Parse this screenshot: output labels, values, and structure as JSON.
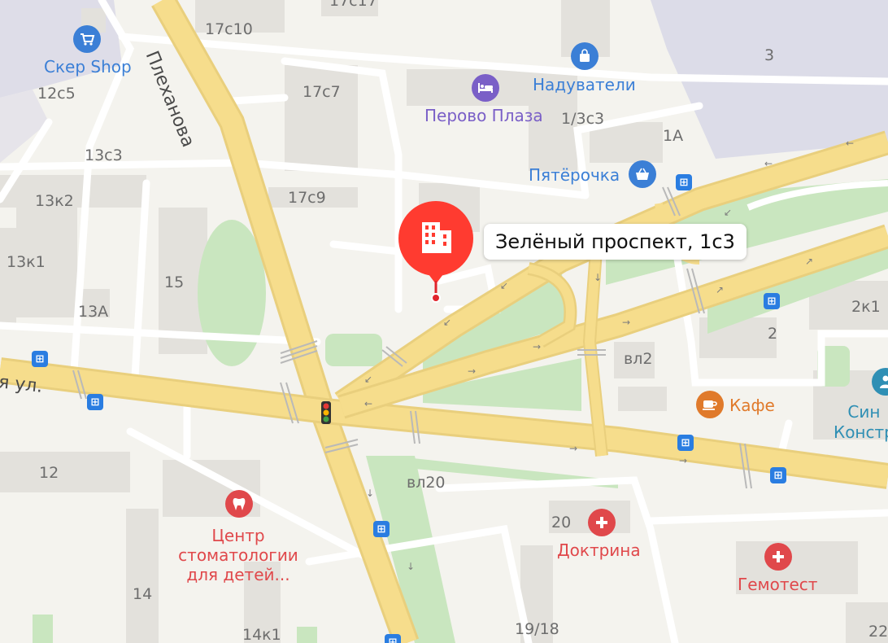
{
  "map": {
    "selected": {
      "address": "Зелёный проспект, 1с3"
    },
    "streets": [
      {
        "id": "plekhanova",
        "text": "Плеханова"
      },
      {
        "id": "left-street",
        "text": "я ул."
      }
    ],
    "pois": [
      {
        "id": "skep-shop",
        "text": "Скер Shop",
        "icon": "shopping-cart-icon",
        "color": "#3b7fd6"
      },
      {
        "id": "naduvateli",
        "text": "Надуватели",
        "icon": "shopping-bag-icon",
        "color": "#3b7fd6"
      },
      {
        "id": "perovo-plaza",
        "text": "Перово Плаза",
        "icon": "hotel-bed-icon",
        "color": "#7a5fc7"
      },
      {
        "id": "pyaterochka",
        "text": "Пятёрочка",
        "icon": "shopping-basket-icon",
        "color": "#3b7fd6"
      },
      {
        "id": "kafe",
        "text": "Кафе",
        "icon": "coffee-cup-icon",
        "color": "#e07a2b"
      },
      {
        "id": "centr-stom",
        "text": "Центр\nстоматологии\nдля детей...",
        "icon": "tooth-icon",
        "color": "#e0484b"
      },
      {
        "id": "doktrina",
        "text": "Доктрина",
        "icon": "medical-cross-icon",
        "color": "#e0484b"
      },
      {
        "id": "gemotest",
        "text": "Гемотест",
        "icon": "medical-cross-icon",
        "color": "#e0484b"
      },
      {
        "id": "sin",
        "text": "Син\nКонстр",
        "icon": "person-icon",
        "color": "#2f8fb4"
      }
    ],
    "building_numbers": [
      "17с17",
      "17с10",
      "12с5",
      "3",
      "17с7",
      "1/3с3",
      "1А",
      "13с3",
      "17с9",
      "13к2",
      "13к1",
      "15",
      "13А",
      "2к1",
      "2",
      "вл2",
      "12",
      "вл20",
      "20",
      "14",
      "14к1",
      "19/18",
      "22"
    ],
    "transport": {
      "bus_stop_icon": "bus-stop-icon",
      "traffic_light_icon": "traffic-light-icon"
    }
  }
}
